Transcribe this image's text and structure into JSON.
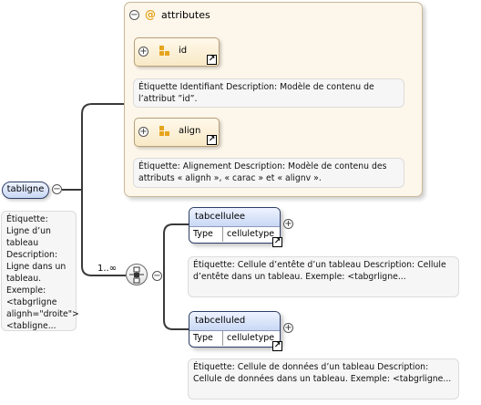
{
  "attributes": {
    "title": "attributes",
    "symbol": "@",
    "items": [
      {
        "name": "id",
        "description": "Étiquette Identifiant Description: Modèle de contenu de l’attribut ”id”."
      },
      {
        "name": "align",
        "description": "Étiquette: Alignement Description: Modèle de contenu des attributs « alignh », « carac » et « alignv »."
      }
    ]
  },
  "root": {
    "name": "tabligne",
    "description": "Étiquette: Ligne d’un tableau Description: Ligne dans un tableau. Exemple: <tabgrligne alignh=\"droite\"> <tabligne..."
  },
  "sequence": {
    "cardinality": "1..∞"
  },
  "children": [
    {
      "name": "tabcellulee",
      "type_label": "Type",
      "type_value": "celluletype",
      "description": "Étiquette: Cellule d’entête d’un tableau Description: Cellule d’entête dans un tableau. Exemple: <tabgrligne..."
    },
    {
      "name": "tabcelluled",
      "type_label": "Type",
      "type_value": "celluletype",
      "description": "Étiquette: Cellule de données d’un tableau Description: Cellule de données dans un tableau. Exemple: <tabgrligne..."
    }
  ],
  "glyphs": {
    "collapse": "−",
    "expand": "+",
    "ref": "↗"
  },
  "colors": {
    "attribute_fill": "#fdf6ea",
    "attribute_icon": "#e5a41f",
    "element_header": "#c9d8f5",
    "border": "#2f3f66"
  }
}
